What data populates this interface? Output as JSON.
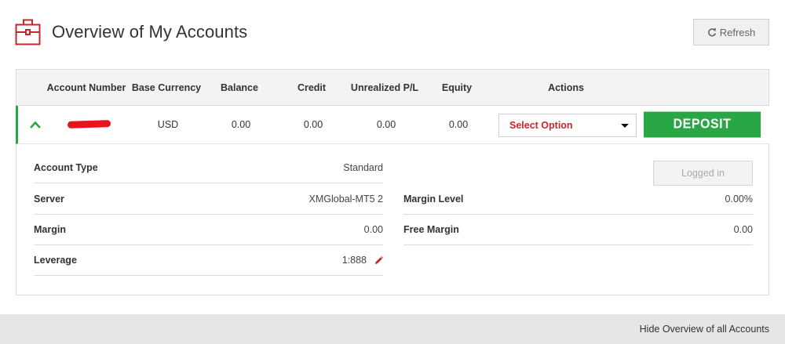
{
  "header": {
    "title": "Overview of My Accounts",
    "refresh_label": "Refresh",
    "icon": "briefcase-icon",
    "accent_color": "#c9252c"
  },
  "table": {
    "columns": [
      "Account Number",
      "Base Currency",
      "Balance",
      "Credit",
      "Unrealized P/L",
      "Equity",
      "Actions"
    ],
    "row": {
      "account_number": "",
      "base_currency": "USD",
      "balance": "0.00",
      "credit": "0.00",
      "unrealized_pl": "0.00",
      "equity": "0.00",
      "select_placeholder": "Select Option",
      "deposit_label": "DEPOSIT"
    }
  },
  "details": {
    "left": [
      {
        "label": "Account Type",
        "value": "Standard"
      },
      {
        "label": "Server",
        "value": "XMGlobal-MT5 2"
      },
      {
        "label": "Margin",
        "value": "0.00"
      },
      {
        "label": "Leverage",
        "value": "1:888"
      }
    ],
    "right": [
      {
        "label": "Margin Level",
        "value": "0.00%"
      },
      {
        "label": "Free Margin",
        "value": "0.00"
      }
    ],
    "logged_in_label": "Logged in"
  },
  "footer": {
    "hide_label": "Hide Overview of all Accounts"
  },
  "colors": {
    "deposit_green": "#2aa745",
    "select_red": "#c9252c",
    "redaction_red": "#e8141c"
  }
}
